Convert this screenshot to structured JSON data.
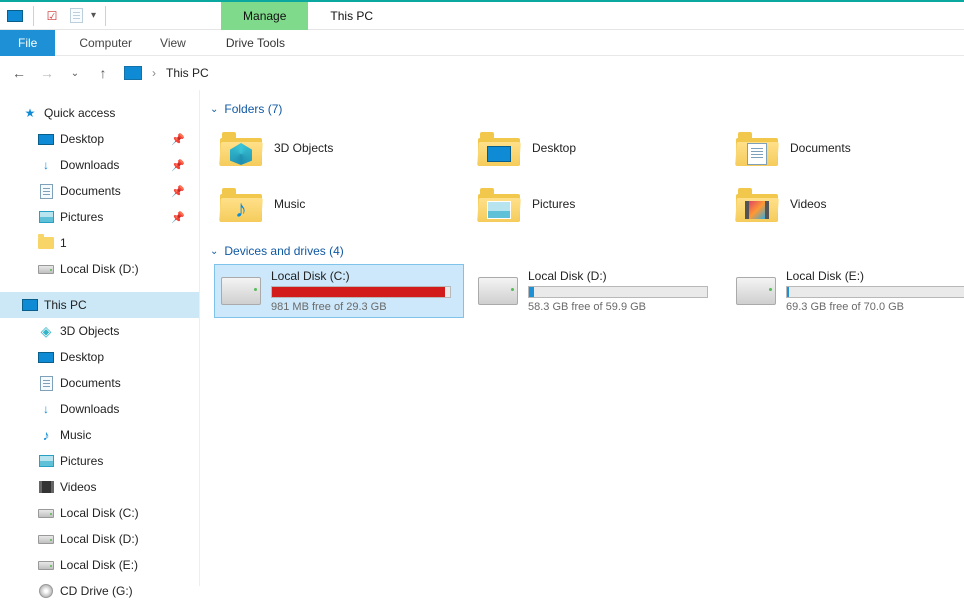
{
  "window": {
    "title": "This PC"
  },
  "ribbon": {
    "context_tab": "Manage",
    "context_group": "Drive Tools",
    "file": "File",
    "tabs": [
      "Computer",
      "View"
    ]
  },
  "breadcrumb": {
    "location": "This PC"
  },
  "sidebar": {
    "quick_access": "Quick access",
    "qa_items": [
      {
        "label": "Desktop",
        "icon": "desktop",
        "pinned": true
      },
      {
        "label": "Downloads",
        "icon": "downloads",
        "pinned": true
      },
      {
        "label": "Documents",
        "icon": "documents",
        "pinned": true
      },
      {
        "label": "Pictures",
        "icon": "pictures",
        "pinned": true
      },
      {
        "label": "1",
        "icon": "folder",
        "pinned": false
      },
      {
        "label": "Local Disk (D:)",
        "icon": "drive",
        "pinned": false
      }
    ],
    "this_pc": "This PC",
    "pc_items": [
      {
        "label": "3D Objects",
        "icon": "3d"
      },
      {
        "label": "Desktop",
        "icon": "desktop"
      },
      {
        "label": "Documents",
        "icon": "documents"
      },
      {
        "label": "Downloads",
        "icon": "downloads"
      },
      {
        "label": "Music",
        "icon": "music"
      },
      {
        "label": "Pictures",
        "icon": "pictures"
      },
      {
        "label": "Videos",
        "icon": "videos"
      },
      {
        "label": "Local Disk (C:)",
        "icon": "drive"
      },
      {
        "label": "Local Disk (D:)",
        "icon": "drive"
      },
      {
        "label": "Local Disk (E:)",
        "icon": "drive"
      },
      {
        "label": "CD Drive (G:)",
        "icon": "cd"
      }
    ]
  },
  "content": {
    "folders_header": "Folders (7)",
    "drives_header": "Devices and drives (4)",
    "folders": [
      {
        "label": "3D Objects",
        "overlay": "3d"
      },
      {
        "label": "Desktop",
        "overlay": "desktop"
      },
      {
        "label": "Documents",
        "overlay": "doc"
      },
      {
        "label": "Music",
        "overlay": "music"
      },
      {
        "label": "Pictures",
        "overlay": "pic"
      },
      {
        "label": "Videos",
        "overlay": "video"
      }
    ],
    "drives": [
      {
        "name": "Local Disk (C:)",
        "free": "981 MB free of 29.3 GB",
        "pct": 97,
        "color": "red",
        "selected": true
      },
      {
        "name": "Local Disk (D:)",
        "free": "58.3 GB free of 59.9 GB",
        "pct": 3,
        "color": "blue",
        "selected": false
      },
      {
        "name": "Local Disk (E:)",
        "free": "69.3 GB free of 70.0 GB",
        "pct": 1,
        "color": "blue",
        "selected": false
      }
    ]
  }
}
